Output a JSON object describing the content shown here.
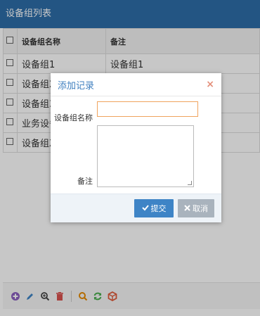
{
  "panel": {
    "title": "设备组列表"
  },
  "grid": {
    "columns": [
      "设备组名称",
      "备注"
    ],
    "rows": [
      {
        "name": "设备组1",
        "note": "设备组1"
      },
      {
        "name": "设备组2",
        "note": ""
      },
      {
        "name": "设备组3",
        "note": ""
      },
      {
        "name": "业务设备",
        "note": ""
      },
      {
        "name": "设备组X",
        "note": ""
      }
    ]
  },
  "toolbar": {
    "icons": [
      "add-icon",
      "edit-icon",
      "view-icon",
      "delete-icon",
      "search-icon",
      "refresh-icon",
      "export-icon"
    ],
    "colors": {
      "add": "#8b5fbf",
      "edit": "#3e84c6",
      "view": "#444444",
      "delete": "#d9534f",
      "search": "#e68a00",
      "refresh": "#4caf50",
      "export": "#e05a3a"
    }
  },
  "dialog": {
    "title": "添加记录",
    "close_icon": "×",
    "fields": {
      "name_label": "设备组名称",
      "note_label": "备注",
      "name_value": "",
      "note_value": ""
    },
    "buttons": {
      "submit": "提交",
      "cancel": "取消"
    }
  },
  "colors": {
    "header_bg": "#2d6da8",
    "dialog_title": "#3f7fbf",
    "input_focus": "#f0a35d",
    "submit_bg": "#3e84c6",
    "cancel_bg": "#a9b3bd"
  }
}
